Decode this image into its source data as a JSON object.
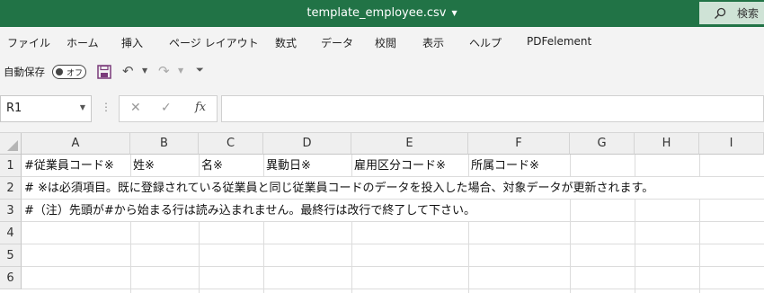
{
  "window": {
    "title": "template_employee.csv",
    "search_label": "検索"
  },
  "menu": {
    "items": [
      "ファイル",
      "ホーム",
      "挿入",
      "ページ レイアウト",
      "数式",
      "データ",
      "校閲",
      "表示",
      "ヘルプ",
      "PDFelement"
    ]
  },
  "qat": {
    "autosave_label": "自動保存",
    "autosave_state": "オフ"
  },
  "formula_bar": {
    "name_box": "R1",
    "fx_label": "fx",
    "value": ""
  },
  "sheet": {
    "columns": [
      "A",
      "B",
      "C",
      "D",
      "E",
      "F",
      "G",
      "H",
      "I"
    ],
    "rows": [
      "1",
      "2",
      "3",
      "4",
      "5",
      "6"
    ],
    "cells": {
      "A1": "#従業員コード※",
      "B1": "姓※",
      "C1": "名※",
      "D1": "異動日※",
      "E1": "雇用区分コード※",
      "F1": "所属コード※",
      "A2": "# ※は必須項目。既に登録されている従業員と同じ従業員コードのデータを投入した場合、対象データが更新されます。",
      "A3": "#（注）先頭が#から始まる行は読み込まれません。最終行は改行で終了して下さい。"
    }
  },
  "colors": {
    "title_bar": "#217346",
    "header_bg": "#efefef",
    "grid_line": "#dcdcdc"
  }
}
